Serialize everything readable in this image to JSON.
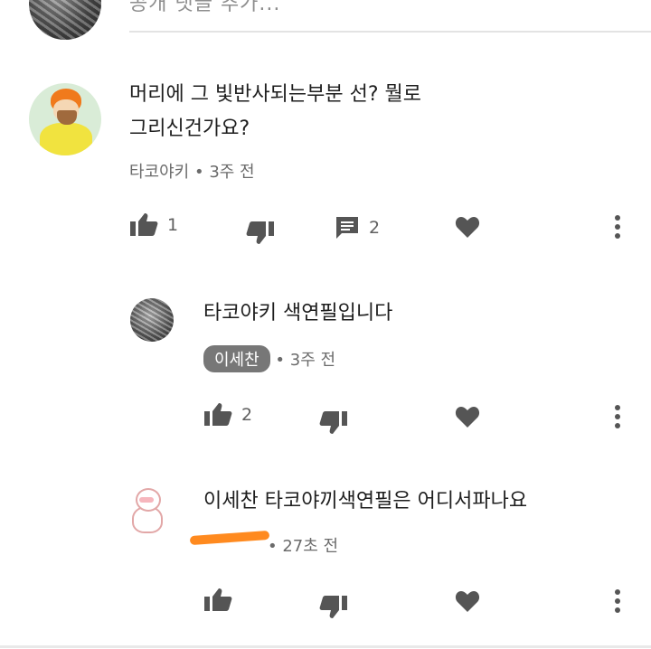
{
  "comment_input": {
    "placeholder": "공개 댓글 추가..."
  },
  "comments": [
    {
      "text_line1": "머리에 그 빛반사되는부분 선? 뭘로",
      "text_line2": "그리신건가요?",
      "author": "타코야키",
      "time": "3주 전",
      "likes": "1",
      "replies": "2"
    },
    {
      "text": "타코야키 색연필입니다",
      "author": "이세찬",
      "time": "3주 전",
      "likes": "2"
    },
    {
      "text": "이세찬 타코야끼색연필은 어디서파나요",
      "time": "27초 전"
    }
  ],
  "colors": {
    "icon": "#555555",
    "meta_text": "#6b6b6b",
    "chip_bg": "#777777",
    "redaction": "#ff8a1f"
  },
  "icons": [
    "like-icon",
    "dislike-icon",
    "reply-icon",
    "heart-icon",
    "more-icon"
  ]
}
